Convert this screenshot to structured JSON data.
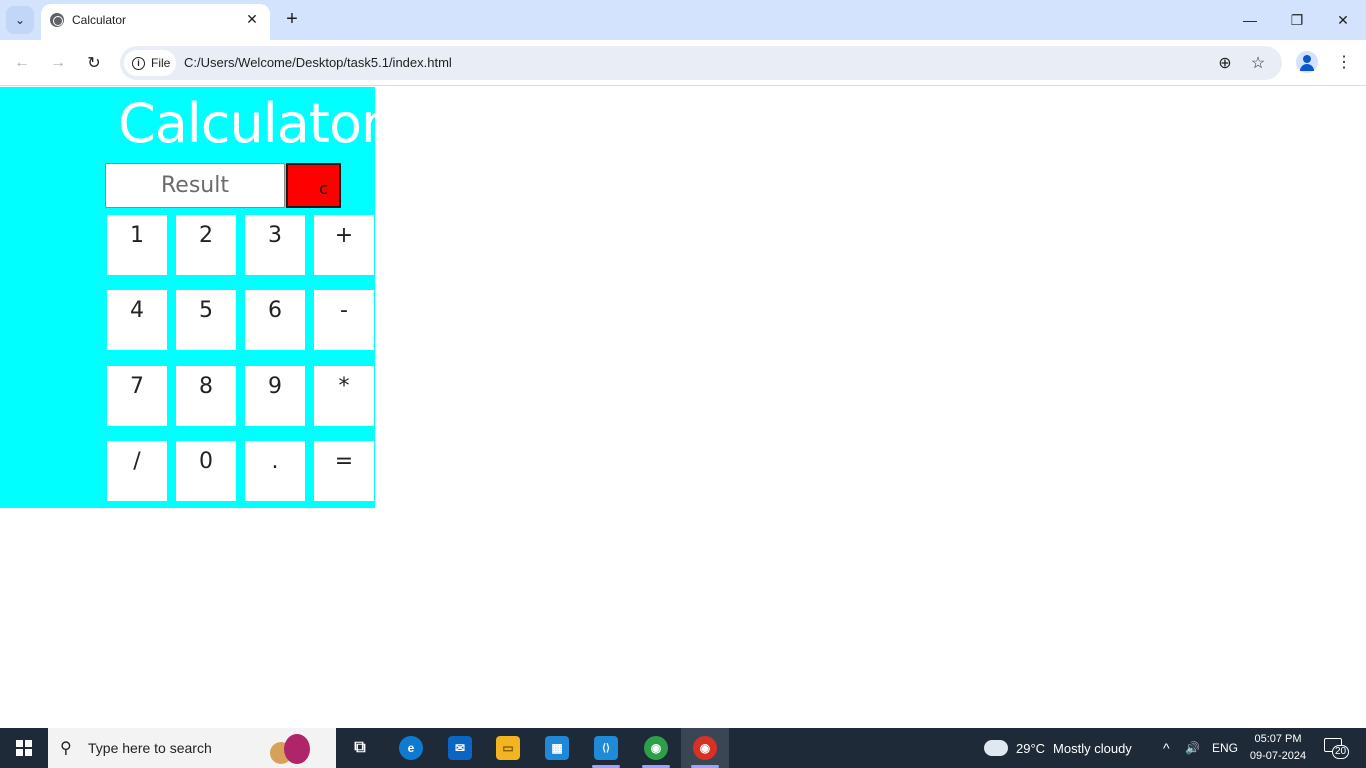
{
  "browser": {
    "tab_title": "Calculator",
    "tab_close_glyph": "✕",
    "new_tab_glyph": "+",
    "tab_menu_glyph": "⌄",
    "window_controls": {
      "minimize": "—",
      "restore": "❐",
      "close": "✕"
    }
  },
  "toolbar": {
    "back_glyph": "←",
    "forward_glyph": "→",
    "reload_glyph": "↻",
    "site_chip_label": "File",
    "url": "C:/Users/Welcome/Desktop/task5.1/index.html",
    "zoom_glyph": "⊕",
    "bookmark_glyph": "☆",
    "menu_glyph": "⋮"
  },
  "calculator": {
    "title": "Calculator",
    "result_placeholder": "Result",
    "clear_label": "c",
    "keys": [
      "1",
      "2",
      "3",
      "+",
      "4",
      "5",
      "6",
      "-",
      "7",
      "8",
      "9",
      "*",
      "/",
      "0",
      ".",
      "="
    ],
    "colors": {
      "background": "#00ffff",
      "clear_button": "#ff0000",
      "key": "#ffffff"
    }
  },
  "taskbar": {
    "search_placeholder": "Type here to search",
    "search_glyph": "⚲",
    "weather_temp": "29°C",
    "weather_text": "Mostly cloudy",
    "tray_chevron": "^",
    "volume_glyph": "🔊",
    "language": "ENG",
    "time": "05:07 PM",
    "date": "09-07-2024",
    "notification_count": "20",
    "apps": [
      {
        "name": "task-view",
        "glyph": "⧉",
        "color": "#1e2a38"
      },
      {
        "name": "edge",
        "glyph": "e",
        "color": "#0f7bd0"
      },
      {
        "name": "mail",
        "glyph": "✉",
        "color": "#0a66c2"
      },
      {
        "name": "file-explorer",
        "glyph": "▭",
        "color": "#f2b420"
      },
      {
        "name": "microsoft-store",
        "glyph": "▦",
        "color": "#1f88d8"
      },
      {
        "name": "vs-code",
        "glyph": "⟨⟩",
        "color": "#1e8ad8"
      },
      {
        "name": "chrome",
        "glyph": "◉",
        "color": "#2e9e4b"
      },
      {
        "name": "chrome-active",
        "glyph": "◉",
        "color": "#d93025"
      }
    ]
  }
}
